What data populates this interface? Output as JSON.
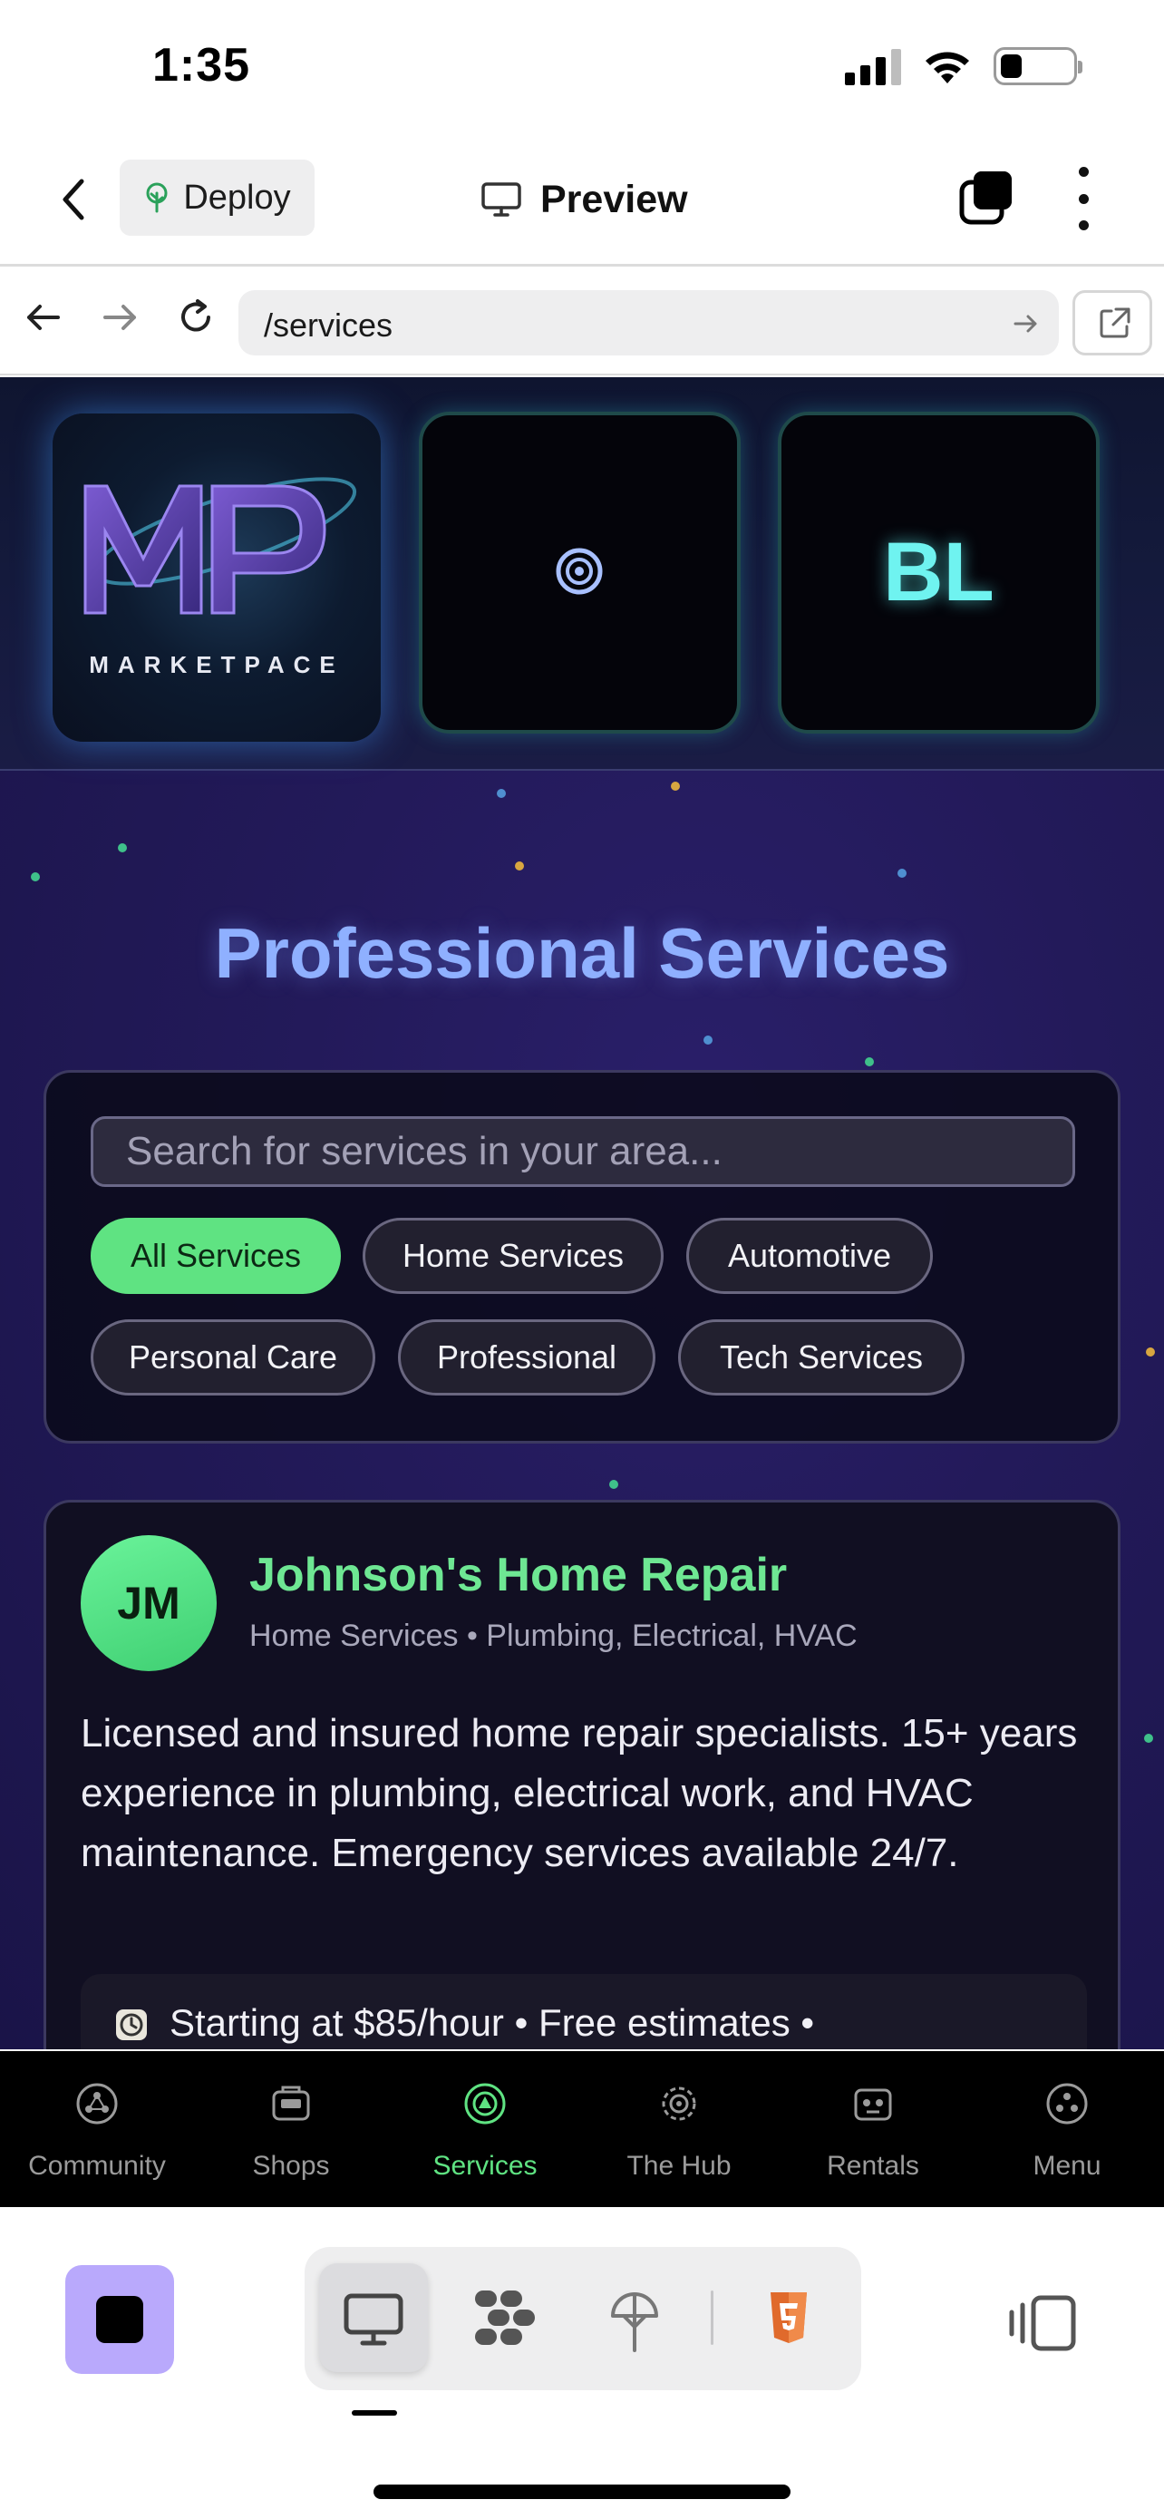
{
  "status_bar": {
    "time": "1:35"
  },
  "header": {
    "deploy_label": "Deploy",
    "preview_label": "Preview"
  },
  "browser": {
    "url": "/services"
  },
  "hero": {
    "logo_caption": "MARKETPACE",
    "bl_text": "BL",
    "title": "Professional Services"
  },
  "search": {
    "placeholder": "Search for services in your area..."
  },
  "filters": {
    "all": "All Services",
    "home": "Home Services",
    "automotive": "Automotive",
    "personal": "Personal Care",
    "professional": "Professional",
    "tech": "Tech Services"
  },
  "provider": {
    "initials": "JM",
    "name": "Johnson's Home Repair",
    "meta": "Home Services • Plumbing, Electrical, HVAC",
    "description": "Licensed and insured home repair specialists. 15+ years experience in plumbing, electrical work, and HVAC maintenance. Emergency services available 24/7.",
    "pricing": "Starting at $85/hour • Free estimates •"
  },
  "bottom_nav": {
    "community": "Community",
    "shops": "Shops",
    "services": "Services",
    "hub": "The Hub",
    "rentals": "Rentals",
    "menu": "Menu"
  },
  "colors": {
    "accent_green": "#5fe382",
    "title_blue": "#8fb0ff",
    "stop_purple": "#b9a9fc",
    "html5_orange": "#e06a2c"
  },
  "battery_level": 0.3
}
